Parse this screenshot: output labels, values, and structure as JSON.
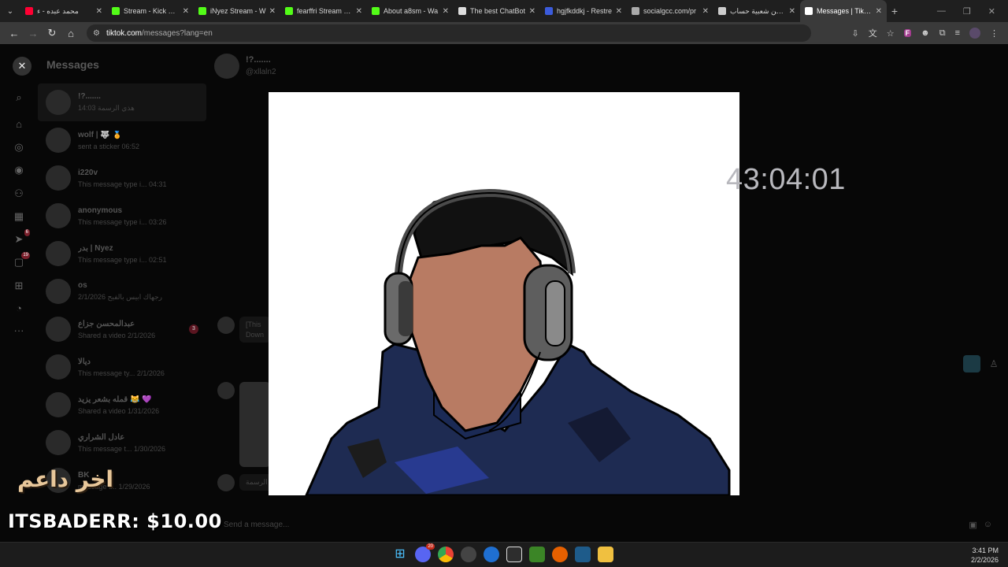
{
  "browser": {
    "tabs": [
      {
        "title": "محمد عبده - ء",
        "favicon_color": "#ff0033",
        "active": false
      },
      {
        "title": "Stream - Kick Dash",
        "favicon_color": "#53fc18",
        "active": false
      },
      {
        "title": "iNyez Stream - W",
        "favicon_color": "#53fc18",
        "active": false
      },
      {
        "title": "fearffri Stream - W",
        "favicon_color": "#53fc18",
        "active": false
      },
      {
        "title": "About a8sm - Wa",
        "favicon_color": "#53fc18",
        "active": false
      },
      {
        "title": "The best ChatBot",
        "favicon_color": "#dddddd",
        "active": false
      },
      {
        "title": "hgjfkddkj - Restre",
        "favicon_color": "#3b5bdb",
        "active": false
      },
      {
        "title": "socialgcc.com/pr",
        "favicon_color": "#aaaaaa",
        "active": false
      },
      {
        "title": "زد من شعبية حساب",
        "favicon_color": "#cccccc",
        "active": false
      },
      {
        "title": "Messages | TikTok",
        "favicon_color": "#ffffff",
        "active": true
      }
    ],
    "url_host": "tiktok.com",
    "url_path": "/messages?lang=en"
  },
  "messages": {
    "title": "Messages",
    "conversations": [
      {
        "name": "!?.......",
        "preview": "هذي الرسمة 14:03",
        "active": true,
        "unread": ""
      },
      {
        "name": "wolf | 🐺 🏅",
        "preview": "sent a sticker 06:52",
        "active": false,
        "unread": ""
      },
      {
        "name": "i220v",
        "preview": "This message type i... 04:31",
        "active": false,
        "unread": ""
      },
      {
        "name": "anonymous",
        "preview": "This message type i... 03:26",
        "active": false,
        "unread": ""
      },
      {
        "name": "بدر | Nyez",
        "preview": "This message type i... 02:51",
        "active": false,
        "unread": ""
      },
      {
        "name": "os",
        "preview": "رجهاك ابيس بالفيح 2/1/2026",
        "active": false,
        "unread": ""
      },
      {
        "name": "عبدالمحسن جزاع",
        "preview": "Shared a video 2/1/2026",
        "active": false,
        "unread": "3"
      },
      {
        "name": "ديالا",
        "preview": "This message ty... 2/1/2026",
        "active": false,
        "unread": ""
      },
      {
        "name": "قمله بشعر يزيد 😹 💜",
        "preview": "Shared a video 1/31/2026",
        "active": false,
        "unread": ""
      },
      {
        "name": "عادل الشراري",
        "preview": "This message t... 1/30/2026",
        "active": false,
        "unread": ""
      },
      {
        "name": "BK",
        "preview": "message t... 1/29/2026",
        "active": false,
        "unread": ""
      }
    ]
  },
  "chat": {
    "contact_name": "!?.......",
    "contact_handle": "@xllaln2",
    "bubble1_line1": "[This",
    "bubble1_line2": "Down",
    "bubble2": "الرسمة",
    "input_placeholder": "Send a message..."
  },
  "overlay": {
    "timer": "43:04:01",
    "donor_label": "اخر داعم",
    "donation_text": "ITSBADERR: $10.00"
  },
  "rail_badges": {
    "inbox": "6",
    "messages": "19"
  },
  "taskbar": {
    "time": "3:41 PM",
    "date": "2/2/2026",
    "discord_badge": "20"
  }
}
